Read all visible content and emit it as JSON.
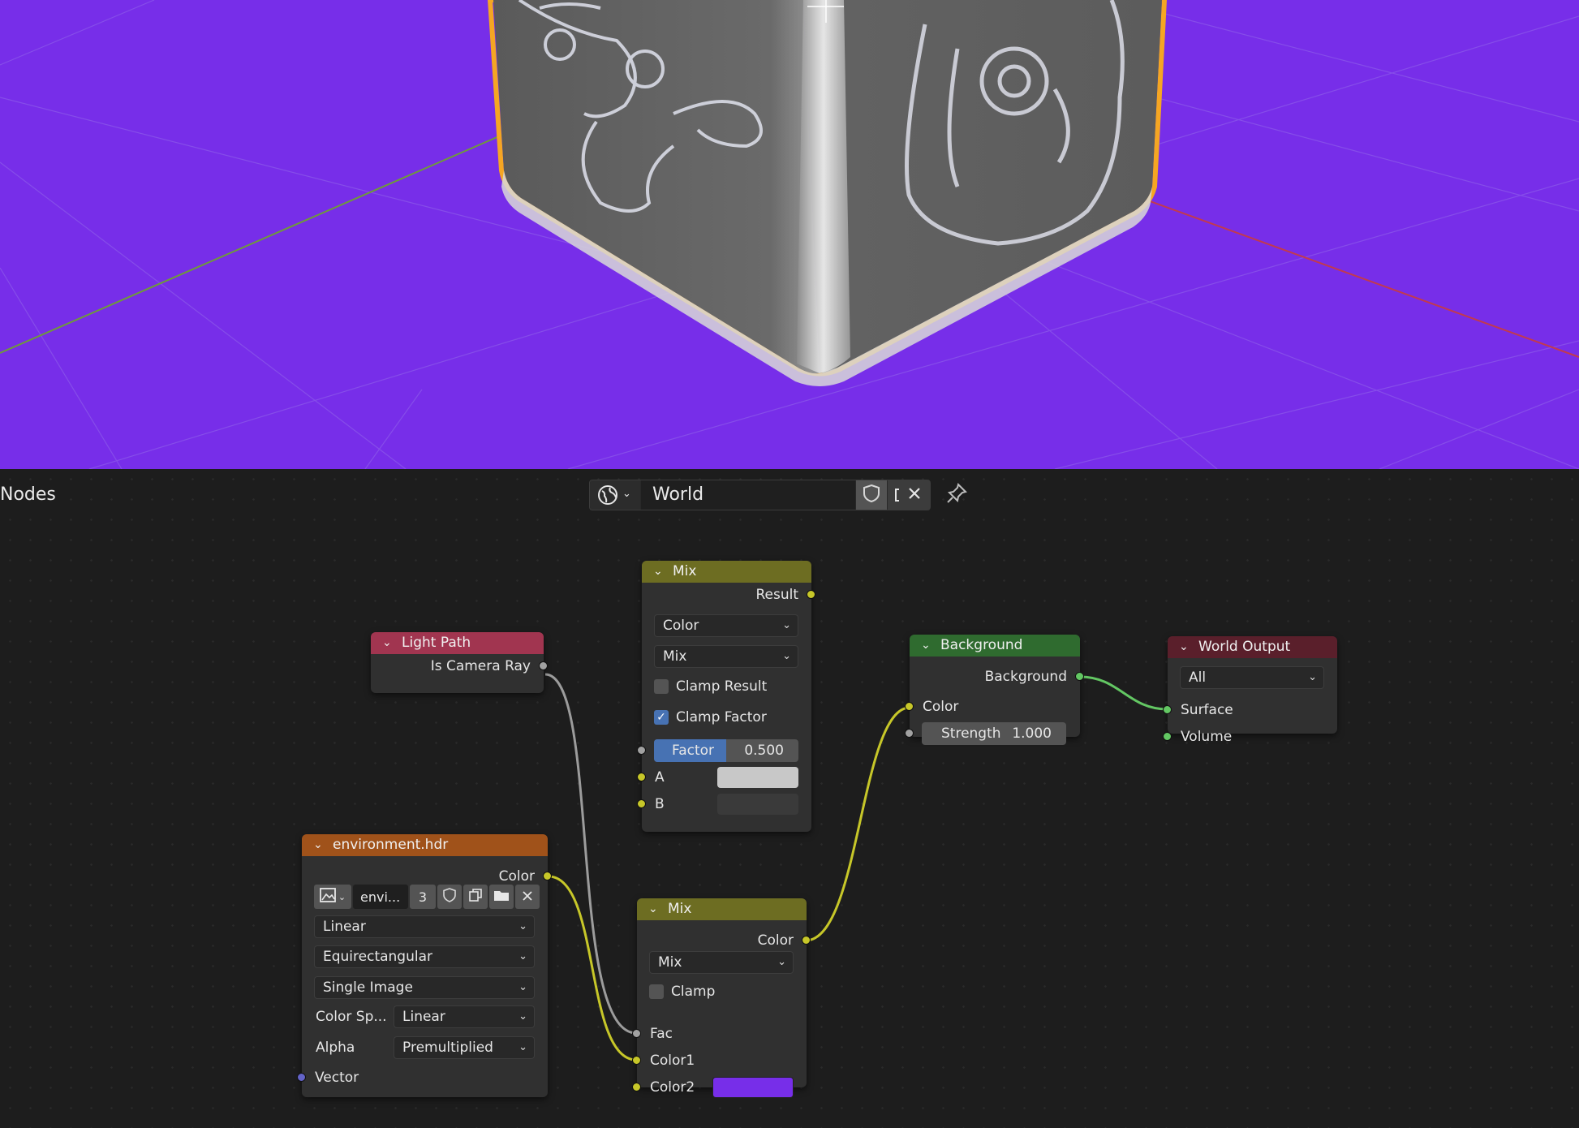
{
  "editor": {
    "title": "Nodes",
    "datablock": {
      "name": "World",
      "type_icon": "world-globe-icon",
      "fake_user_icon": "shield-icon",
      "duplicate_icon": "duplicate-icon",
      "unlink_icon": "close-icon",
      "pin_icon": "pin-icon"
    }
  },
  "nodes": {
    "light_path": {
      "title": "Light Path",
      "output": "Is Camera Ray"
    },
    "mix_top": {
      "title": "Mix",
      "output": "Result",
      "data_type": "Color",
      "blend_mode": "Mix",
      "clamp_result_label": "Clamp Result",
      "clamp_result": false,
      "clamp_factor_label": "Clamp Factor",
      "clamp_factor": true,
      "factor_label": "Factor",
      "factor_value": "0.500",
      "factor_fraction": 0.5,
      "input_a": "A",
      "input_b": "B",
      "color_a": "#c8c8c8",
      "color_b": "#3a3a3a"
    },
    "background": {
      "title": "Background",
      "output": "Background",
      "input_color": "Color",
      "strength_label": "Strength",
      "strength_value": "1.000"
    },
    "world_output": {
      "title": "World Output",
      "target": "All",
      "input_surface": "Surface",
      "input_volume": "Volume"
    },
    "env_texture": {
      "title": "environment.hdr",
      "output": "Color",
      "image_name": "envi...",
      "users": "3",
      "interpolation": "Linear",
      "projection": "Equirectangular",
      "source": "Single Image",
      "color_space_label": "Color Sp...",
      "color_space": "Linear",
      "alpha_label": "Alpha",
      "alpha": "Premultiplied",
      "input_vector": "Vector"
    },
    "mix_bottom": {
      "title": "Mix",
      "output": "Color",
      "blend_mode": "Mix",
      "clamp_label": "Clamp",
      "clamp": false,
      "input_fac": "Fac",
      "input_color1": "Color1",
      "input_color2": "Color2",
      "color2": "#772ee9"
    }
  },
  "colors": {
    "viewport_background": "#772ee9",
    "header_input": "#a13550",
    "header_converter": "#6d6d22",
    "header_shader": "#2f6b2f",
    "header_texture": "#a0521a",
    "header_output": "#5a1f2b",
    "socket_color": "#c7c729",
    "socket_float": "#a1a1a1",
    "socket_shader": "#63c763",
    "socket_vector": "#6363c7",
    "selection_outline": "#f5a623"
  }
}
